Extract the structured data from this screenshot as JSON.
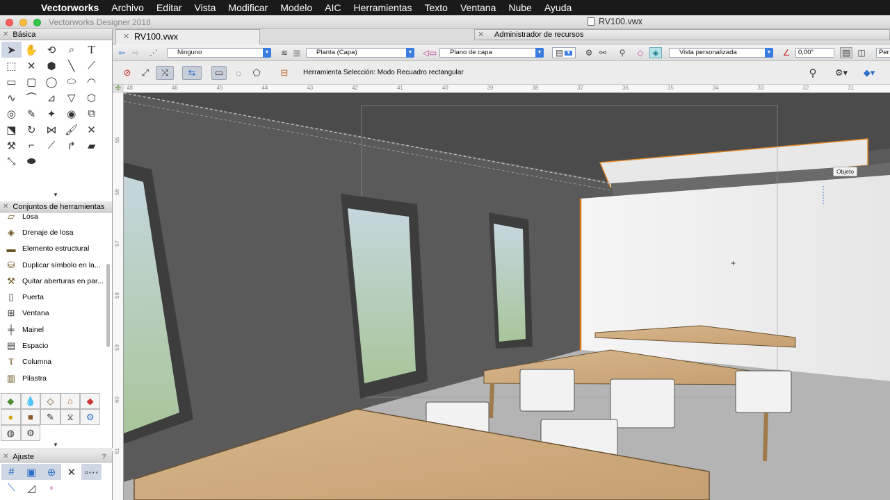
{
  "menubar": {
    "app_name": "Vectorworks",
    "items": [
      "Archivo",
      "Editar",
      "Vista",
      "Modificar",
      "Modelo",
      "AIC",
      "Herramientas",
      "Texto",
      "Ventana",
      "Nube",
      "Ayuda"
    ]
  },
  "window": {
    "app_title": "Vectorworks Designer 2018",
    "doc_title": "RV100.vwx"
  },
  "tabs": {
    "document_tab": "RV100.vwx",
    "resource_tab": "Administrador de recursos"
  },
  "palettes": {
    "basic": {
      "title": "Básica",
      "tools": [
        "arrow",
        "hand",
        "rotate-view",
        "zoom",
        "text",
        "marquee",
        "x",
        "flyover",
        "line",
        "double-line",
        "rectangle",
        "rounded-rect",
        "circle",
        "oval",
        "circle-arc",
        "polyline",
        "arc",
        "quad",
        "tri",
        "hexagon",
        "spiral",
        "eyedropper",
        "magic-wand",
        "pointer-eye",
        "clip",
        "reshape",
        "rotate-3d",
        "mirror",
        "brush",
        "cross",
        "attribute",
        "trim-1",
        "arc-fillet",
        "chamfer",
        "eraser",
        "connect",
        "symbol"
      ]
    },
    "toolsets": {
      "title": "Conjuntos de herramientas",
      "items": [
        {
          "label": "Losa",
          "icon": "slab-icon"
        },
        {
          "label": "Drenaje de losa",
          "icon": "slab-drainage-icon"
        },
        {
          "label": "Elemento estructural",
          "icon": "structural-member-icon"
        },
        {
          "label": "Duplicar símbolo en la...",
          "icon": "duplicate-symbol-icon"
        },
        {
          "label": "Quitar aberturas en par...",
          "icon": "remove-openings-icon"
        },
        {
          "label": "Puerta",
          "icon": "door-icon"
        },
        {
          "label": "Ventana",
          "icon": "window-icon"
        },
        {
          "label": "Mainel",
          "icon": "mullion-icon"
        },
        {
          "label": "Espacio",
          "icon": "space-icon"
        },
        {
          "label": "Columna",
          "icon": "column-icon"
        },
        {
          "label": "Pilastra",
          "icon": "pilaster-icon"
        }
      ]
    },
    "snap": {
      "title": "Ajuste",
      "help": "?"
    }
  },
  "viewbar": {
    "class_select": "Ninguno",
    "layer_select": "Planta (Capa)",
    "plane_select": "Plano de capa",
    "view_select": "Vista personalizada",
    "angle_value": "0,00°",
    "right_truncated": "Per"
  },
  "modebar": {
    "label": "Herramienta Selección: Modo Recuadro rectangular"
  },
  "canvas": {
    "tooltip": "Objeto"
  },
  "rulers": {
    "top": [
      "48",
      "46",
      "45",
      "44",
      "43",
      "42",
      "41",
      "40",
      "39",
      "38",
      "37",
      "36",
      "35",
      "34",
      "33",
      "32",
      "31"
    ],
    "left": [
      "55",
      "56",
      "57",
      "58",
      "59",
      "60",
      "61"
    ]
  },
  "colors": {
    "menubar_bg": "#1a1a1a",
    "accent_blue": "#3a7ce0",
    "selection_orange": "#e07a1a"
  }
}
